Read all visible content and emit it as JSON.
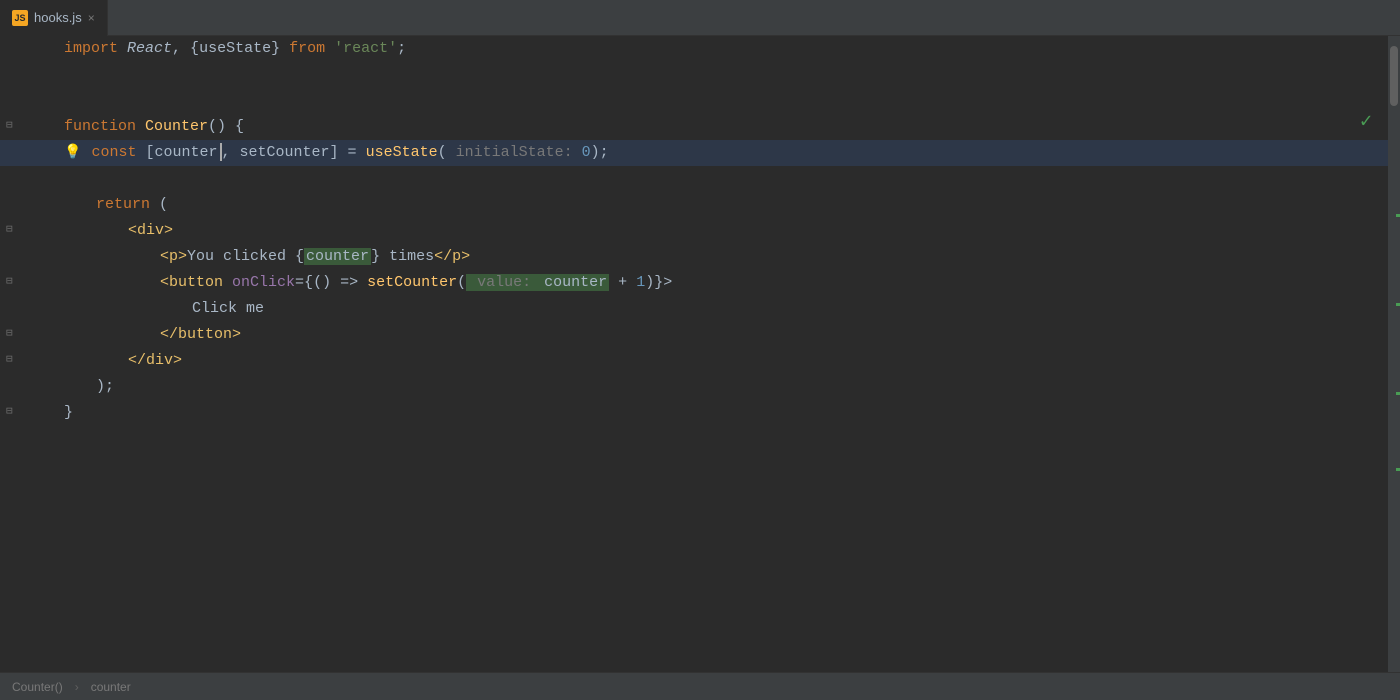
{
  "tab": {
    "icon_label": "JS",
    "name": "hooks.js",
    "close_label": "×"
  },
  "checkmark": "✓",
  "lines": [
    {
      "number": "",
      "content_html": "<span class='import-kw'>import</span> <span class='react-cls italic'>React</span><span class='punc'>, {</span><span class='use-state'>useState</span><span class='punc'>}</span> <span class='from-kw'>from</span> <span class='react-str'>'react'</span><span class='punc'>;</span>",
      "active": false,
      "fold": false,
      "empty": false
    },
    {
      "number": "",
      "content_html": "",
      "active": false,
      "fold": false,
      "empty": true
    },
    {
      "number": "",
      "content_html": "",
      "active": false,
      "fold": false,
      "empty": true
    },
    {
      "number": "",
      "content_html": "<span class='kw'>function</span> <span class='fn'>Counter</span><span class='punc'>() {</span>",
      "active": false,
      "fold": true,
      "fold_char": "⊟"
    },
    {
      "number": "",
      "content_html": "<span class='lightbulb'>💡</span><span style='margin-left:8px'><span class='kw'>const</span> <span class='punc'>[</span><span class='destructure'>counter</span><span class='cursor'></span><span class='punc'>,</span> <span class='destructure'>setCounter</span><span class='punc'>]</span> <span class='operator'>=</span> <span class='hook-name'>useState</span><span class='punc'>(</span><span class='param-hint'> initialState: </span><span class='number'>0</span><span class='punc'>);</span></span>",
      "active": true,
      "fold": false,
      "indent": 1
    },
    {
      "number": "",
      "content_html": "",
      "active": false,
      "fold": false,
      "empty": true
    },
    {
      "number": "",
      "content_html": "    <span class='kw'>return</span> <span class='punc'>(</span>",
      "active": false,
      "fold": false
    },
    {
      "number": "",
      "content_html": "        <span class='jsx-tag'>&lt;div&gt;</span>",
      "active": false,
      "fold": true,
      "fold_char": "⊟"
    },
    {
      "number": "",
      "content_html": "            <span class='jsx-tag'>&lt;p&gt;</span><span class='var'>You clicked {</span><span class='counter-highlight'>counter</span><span class='var'>} times</span><span class='jsx-tag'>&lt;/p&gt;</span>",
      "active": false,
      "fold": false
    },
    {
      "number": "",
      "content_html": "            <span class='jsx-tag'>&lt;button</span> <span class='jsx-attr'>onClick</span><span class='punc'>={</span><span class='punc'>() =&gt;</span> <span class='hook-name'>setCounter</span><span class='punc'>(</span><span class='value-highlight'> value: </span><span class='counter-highlight'>counter</span> <span class='operator'>+</span> <span class='number'>1</span><span class='punc'>)}&gt;</span>",
      "active": false,
      "fold": true,
      "fold_char": "⊟"
    },
    {
      "number": "",
      "content_html": "                <span class='var'>Click me</span>",
      "active": false,
      "fold": false
    },
    {
      "number": "",
      "content_html": "            <span class='jsx-tag'>&lt;/button&gt;</span>",
      "active": false,
      "fold": true,
      "fold_char": "⊟"
    },
    {
      "number": "",
      "content_html": "        <span class='jsx-tag'>&lt;/div&gt;</span>",
      "active": false,
      "fold": false
    },
    {
      "number": "",
      "content_html": "    <span class='punc'>);</span>",
      "active": false,
      "fold": false
    },
    {
      "number": "",
      "content_html": "<span class='punc'>}</span>",
      "active": false,
      "fold": true,
      "fold_char": "⊟"
    }
  ],
  "status_bar": {
    "function_label": "Counter()",
    "separator": "›",
    "variable_label": "counter"
  },
  "scroll_indicators": [
    {
      "top_pct": 30
    },
    {
      "top_pct": 43
    },
    {
      "top_pct": 56
    },
    {
      "top_pct": 68
    }
  ]
}
